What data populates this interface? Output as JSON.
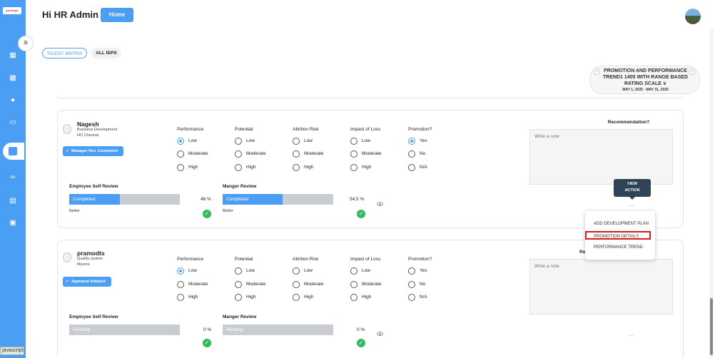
{
  "app": {
    "logo_text": "yourlogo"
  },
  "header": {
    "greeting": "Hi HR Admin",
    "home_label": "Home"
  },
  "sidebar": {
    "icons": [
      "dashboard-icon",
      "book-icon",
      "users-icon",
      "book-open-icon",
      "chart-icon",
      "handshake-icon",
      "checklist-icon",
      "calendar-icon"
    ],
    "active": "chart-icon",
    "toggle_icon": "menu-collapse-icon"
  },
  "tabs": {
    "talent_matrix": "TALENT MATRIX",
    "all_idps": "ALL IDPS",
    "active": "TALENT MATRIX"
  },
  "cycle": {
    "title": "PROMOTION AND PERFORMANCE TREND1 1405 WITH RANGE BASED RATING SCALE",
    "caret": "∨",
    "dates": "MAY 1, 2025 - MAY 31, 2025",
    "prev": "‹",
    "next": "›"
  },
  "columns": {
    "performance": "Performance",
    "potential": "Potential",
    "attrition": "Attrition Risk",
    "impact": "Impact of Loss",
    "promotion": "Promotion?",
    "recommendation": "Recommendation?",
    "rating_options": [
      "Low",
      "Moderate",
      "High"
    ],
    "promotion_options": [
      "Yes",
      "No",
      "N/A"
    ]
  },
  "labels": {
    "self_review": "Employee Self Review",
    "manager_review": "Manger Review",
    "note_placeholder": "Write a note",
    "more": "…"
  },
  "employees": [
    {
      "name": "Nagesh",
      "department": "Business Development",
      "location": "HO Chennai",
      "status": "Manager Rev. Completed",
      "selections": {
        "performance": "Low",
        "potential": null,
        "attrition": null,
        "impact": null,
        "promotion": "Yes"
      },
      "self_review": {
        "status": "Completed",
        "percent": "46 %",
        "value": 46,
        "rating": "Better"
      },
      "manager_review": {
        "status": "Completed",
        "percent": "54.5 %",
        "value": 54.5,
        "rating": "Better"
      }
    },
    {
      "name": "pramodts",
      "department": "Quality system",
      "location": "Mysore",
      "status": "Appraisal Initiated",
      "selections": {
        "performance": "Low",
        "potential": null,
        "attrition": null,
        "impact": null,
        "promotion": null
      },
      "self_review": {
        "status": "Pending",
        "percent": "0 %",
        "value": 0,
        "rating": ""
      },
      "manager_review": {
        "status": "Pending",
        "percent": "0 %",
        "value": 0,
        "rating": ""
      }
    }
  ],
  "recommendation_partial": "Re",
  "view_action": {
    "line1": "VIEW",
    "line2": "ACTION"
  },
  "action_menu": {
    "items": [
      "ADD DEVELOPMENT PLAN",
      "PROMOTION DETAILS",
      "PERFORMANCE TREND"
    ],
    "highlighted": "PROMOTION DETAILS"
  },
  "status_bar": "javascript:",
  "colors": {
    "accent": "#4a9ff5",
    "success": "#2ebd59",
    "tooltip": "#2f4256",
    "highlight": "#d61b1b"
  }
}
